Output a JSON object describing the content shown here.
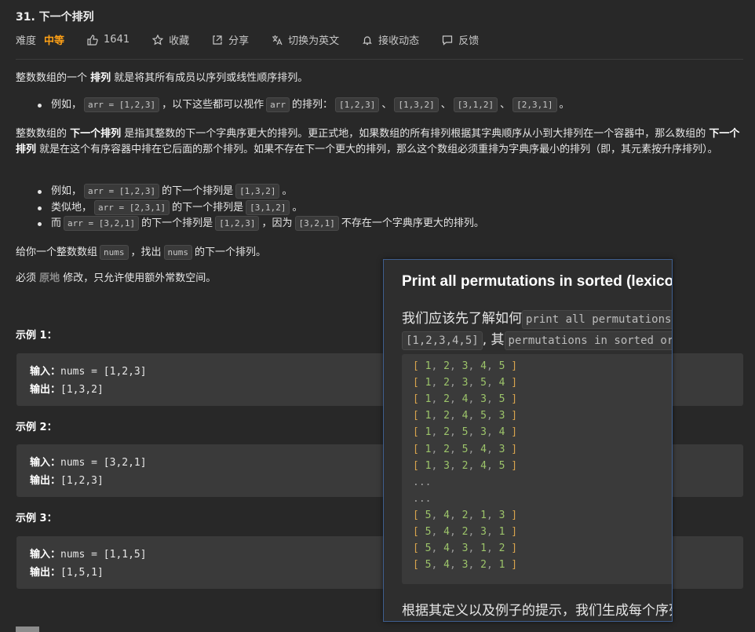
{
  "problem": {
    "title": "31. 下一个排列",
    "difficulty_label": "难度",
    "difficulty_value": "中等",
    "likes": "1641",
    "favorite": "收藏",
    "share": "分享",
    "switch_lang": "切换为英文",
    "subscribe": "接收动态",
    "feedback": "反馈"
  },
  "icons": [
    "thumb-up-icon",
    "star-icon",
    "share-icon",
    "translate-icon",
    "bell-icon",
    "feedback-icon"
  ],
  "desc": {
    "p1_a": "整数数组的一个 ",
    "p1_b": "排列",
    "p1_c": " 就是将其所有成员以序列或线性顺序排列。",
    "b1_a": "例如，",
    "b1_code1": "arr = [1,2,3]",
    "b1_b": "，以下这些都可以视作",
    "b1_code2": "arr",
    "b1_c": "的排列：",
    "b1_p1": "[1,2,3]",
    "b1_p2": "[1,3,2]",
    "b1_p3": "[3,1,2]",
    "b1_p4": "[2,3,1]",
    "sep": "、",
    "period": "。",
    "p2_a": "整数数组的 ",
    "p2_b": "下一个排列",
    "p2_c": " 是指其整数的下一个字典序更大的排列。更正式地，如果数组的所有排列根据其字典顺序从小到大排列在一个容器中，那么数组的 ",
    "p2_d": "下一个排列",
    "p2_e": " 就是在这个有序容器中排在它后面的那个排列。如果不存在下一个更大的排列，那么这个数组必须重排为字典序最小的排列（即，其元素按升序排列）。",
    "l1_a": "例如，",
    "l1_code1": "arr = [1,2,3]",
    "l1_b": "的下一个排列是",
    "l1_code2": "[1,3,2]",
    "l2_a": "类似地，",
    "l2_code1": "arr = [2,3,1]",
    "l2_b": "的下一个排列是",
    "l2_code2": "[3,1,2]",
    "l3_a": "而",
    "l3_code1": "arr = [3,2,1]",
    "l3_b": "的下一个排列是",
    "l3_code2": "[1,2,3]",
    "l3_c": "，因为",
    "l3_code3": "[3,2,1]",
    "l3_d": "不存在一个字典序更大的排列。",
    "p3_a": "给你一个整数数组",
    "p3_code1": "nums",
    "p3_b": "，找出",
    "p3_code2": "nums",
    "p3_c": "的下一个排列。",
    "p4_a": "必须 ",
    "p4_b": "原地",
    "p4_c": " 修改，只允许使用额外常数空间。"
  },
  "examples": [
    {
      "heading": "示例 1：",
      "in_label": "输入：",
      "in_value": "nums = [1,2,3]",
      "out_label": "输出：",
      "out_value": "[1,3,2]"
    },
    {
      "heading": "示例 2：",
      "in_label": "输入：",
      "in_value": "nums = [3,2,1]",
      "out_label": "输出：",
      "out_value": "[1,2,3]"
    },
    {
      "heading": "示例 3：",
      "in_label": "输入：",
      "in_value": "nums = [1,1,5]",
      "out_label": "输出：",
      "out_value": "[1,5,1]"
    }
  ],
  "popup": {
    "title": "Print all permutations in sorted (lexicographic) order",
    "line1_text": "我们应该先了解如何",
    "line1_code": "print all permutations",
    "line2_code1": "[1,2,3,4,5]",
    "line2_text": ", 其",
    "line2_code2": "permutations in sorted order",
    "rows": [
      "[ 1, 2, 3, 4, 5 ]",
      "[ 1, 2, 3, 5, 4 ]",
      "[ 1, 2, 4, 3, 5 ]",
      "[ 1, 2, 4, 5, 3 ]",
      "[ 1, 2, 5, 3, 4 ]",
      "[ 1, 2, 5, 4, 3 ]",
      "[ 1, 3, 2, 4, 5 ]",
      "...",
      "...",
      "[ 5, 4, 2, 1, 3 ]",
      "[ 5, 4, 2, 3, 1 ]",
      "[ 5, 4, 3, 1, 2 ]",
      "[ 5, 4, 3, 2, 1 ]"
    ],
    "footer": "根据其定义以及例子的提示，我们生成每个序列"
  },
  "colors": {
    "accent": "#ffa116",
    "background": "#282828",
    "popup_border": "#3f5f8f"
  }
}
